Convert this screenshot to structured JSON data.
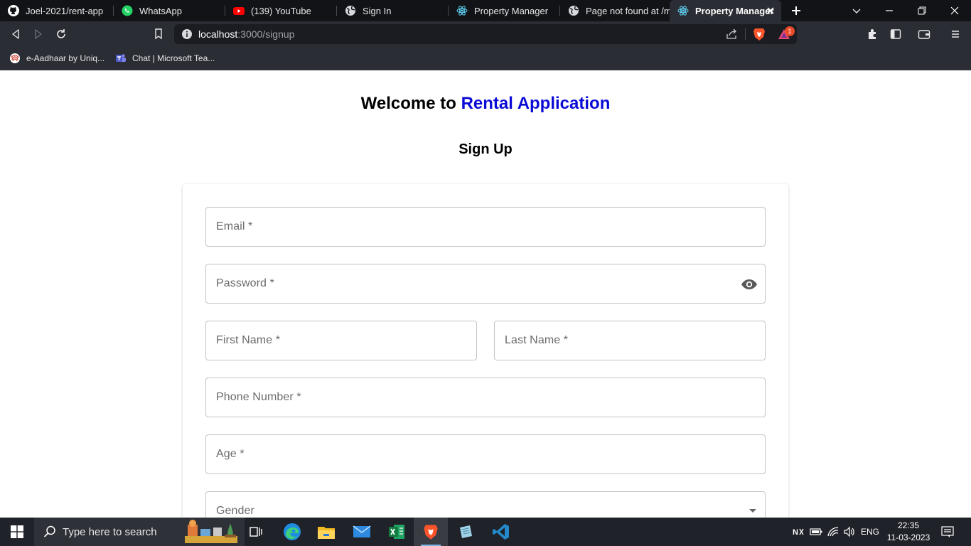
{
  "browser": {
    "tabs": [
      {
        "label": "Joel-2021/rent-app",
        "icon": "github-icon",
        "active": false
      },
      {
        "label": "WhatsApp",
        "icon": "whatsapp-icon",
        "active": false
      },
      {
        "label": "(139) YouTube",
        "icon": "youtube-icon",
        "active": false
      },
      {
        "label": "Sign In",
        "icon": "globe-icon",
        "active": false
      },
      {
        "label": "Property Manager",
        "icon": "react-icon",
        "active": false
      },
      {
        "label": "Page not found at /me",
        "icon": "globe-icon",
        "active": false
      },
      {
        "label": "Property Manager",
        "icon": "react-icon",
        "active": true
      }
    ],
    "address": {
      "host": "localhost",
      "path": ":3000/signup"
    },
    "brave_badge_count": "1",
    "bookmarks": [
      {
        "label": "e-Aadhaar by Uniq...",
        "icon": "aadhaar-icon"
      },
      {
        "label": "Chat | Microsoft Tea...",
        "icon": "teams-icon"
      }
    ],
    "accent_color": "#ea4a2a"
  },
  "page": {
    "welcome_prefix": "Welcome to",
    "welcome_brand": "Rental Application",
    "brand_color": "#0b0bd6",
    "form_title": "Sign Up",
    "fields": {
      "email": "Email *",
      "password": "Password *",
      "first_name": "First Name *",
      "last_name": "Last Name *",
      "phone": "Phone Number *",
      "age": "Age *",
      "gender": "Gender"
    }
  },
  "taskbar": {
    "search_placeholder": "Type here to search",
    "language": "ENG",
    "time": "22:35",
    "date": "11-03-2023",
    "apps": [
      "task-view-icon",
      "edge-icon",
      "file-explorer-icon",
      "mail-icon",
      "excel-icon",
      "brave-icon",
      "notepad-icon",
      "vscode-icon"
    ]
  }
}
